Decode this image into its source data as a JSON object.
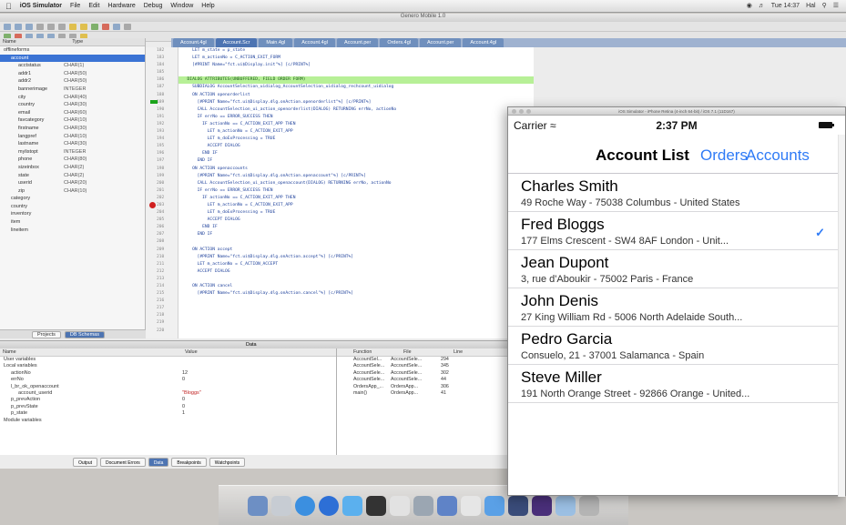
{
  "menubar": {
    "app": "iOS Simulator",
    "items": [
      "File",
      "Edit",
      "Hardware",
      "Debug",
      "Window",
      "Help"
    ],
    "clock": "Tue 14:37",
    "user": "Hal"
  },
  "ide": {
    "window_title": "Genero Mobile 1.0",
    "tabs": [
      "Account.4gl",
      "Account.Scr",
      "Main.4gl",
      "Account.4gl",
      "Account.per",
      "Orders.4gl",
      "Account.per",
      "Account.4gl"
    ],
    "navigator": {
      "header_cols": [
        "Name",
        "Type"
      ],
      "rows": [
        {
          "name": "offlineforms",
          "type": "",
          "indent": 0
        },
        {
          "name": "account",
          "type": "",
          "indent": 1,
          "selected": true
        },
        {
          "name": "acctstatus",
          "type": "CHAR(1)",
          "indent": 2
        },
        {
          "name": "addr1",
          "type": "CHAR(50)",
          "indent": 2
        },
        {
          "name": "addr2",
          "type": "CHAR(50)",
          "indent": 2
        },
        {
          "name": "bannerimage",
          "type": "INTEGER",
          "indent": 2
        },
        {
          "name": "city",
          "type": "CHAR(40)",
          "indent": 2
        },
        {
          "name": "country",
          "type": "CHAR(30)",
          "indent": 2
        },
        {
          "name": "email",
          "type": "CHAR(60)",
          "indent": 2
        },
        {
          "name": "favcategory",
          "type": "CHAR(10)",
          "indent": 2
        },
        {
          "name": "firstname",
          "type": "CHAR(30)",
          "indent": 2
        },
        {
          "name": "langpref",
          "type": "CHAR(10)",
          "indent": 2
        },
        {
          "name": "lastname",
          "type": "CHAR(30)",
          "indent": 2
        },
        {
          "name": "mylistopt",
          "type": "INTEGER",
          "indent": 2
        },
        {
          "name": "phone",
          "type": "CHAR(80)",
          "indent": 2
        },
        {
          "name": "sizeinbox",
          "type": "CHAR(2)",
          "indent": 2
        },
        {
          "name": "state",
          "type": "CHAR(2)",
          "indent": 2
        },
        {
          "name": "userid",
          "type": "CHAR(20)",
          "indent": 2
        },
        {
          "name": "zip",
          "type": "CHAR(10)",
          "indent": 2
        },
        {
          "name": "category",
          "type": "",
          "indent": 1
        },
        {
          "name": "country",
          "type": "",
          "indent": 1
        },
        {
          "name": "inventory",
          "type": "",
          "indent": 1
        },
        {
          "name": "item",
          "type": "",
          "indent": 1
        },
        {
          "name": "lineitem",
          "type": "",
          "indent": 1
        }
      ],
      "footer_tabs": [
        "Projects",
        "DB Schemas"
      ]
    },
    "gutter_lines": [
      "182",
      "183",
      "184",
      "185",
      "186",
      "187",
      "188",
      "189",
      "190",
      "191",
      "192",
      "193",
      "194",
      "195",
      "196",
      "197",
      "198",
      "199",
      "200",
      "201",
      "202",
      "203",
      "204",
      "205",
      "206",
      "207",
      "208",
      "209",
      "210",
      "211",
      "212",
      "213",
      "214",
      "215",
      "216",
      "217",
      "218",
      "219",
      "220"
    ],
    "code_lines": [
      "    LET m_state = p_state",
      "    LET m_actionNo = C_ACTION_EXIT_FORM",
      "    [#PRINT Name=\"fct.ui$Display.init\"%] [c/PRINT%]",
      "",
      "  DIALOG ATTRIBUTES(UNBUFFERED, FIELD ORDER FORM)",
      "    SUBDIALOG AccountSelection_uidialog_AccountSelection_uidialog_rechcount_uidialog",
      "    ON ACTION openorderlist",
      "      [#PRINT Name=\"fct.ui$Display.dlg.onAction.openorderlist\"%] [c/PRINT%]",
      "      CALL AccountSelection_ui_action_openorderlist(DIALOG) RETURNING errNo, actionNo",
      "      IF errNo == ERROR_SUCCESS THEN",
      "        IF actionNo == C_ACTION_EXIT_APP THEN",
      "          LET m_actionNo = C_ACTION_EXIT_APP",
      "          LET m_doExProcessing = TRUE",
      "          ACCEPT DIALOG",
      "        END IF",
      "      END IF",
      "    ON ACTION openaccounts",
      "      [#PRINT Name=\"fct.ui$Display.dlg.onAction.openaccount\"%] [c/PRINT%]",
      "      CALL AccountSelection_ui_action_openaccount(DIALOG) RETURNING errNo, actionNo",
      "      IF errNo == ERROR_SUCCESS THEN",
      "        IF actionNo == C_ACTION_EXIT_APP THEN",
      "          LET m_actionNo = C_ACTION_EXIT_APP",
      "          LET m_doExProcessing = TRUE",
      "          ACCEPT DIALOG",
      "        END IF",
      "      END IF",
      "",
      "    ON ACTION accept",
      "      [#PRINT Name=\"fct.ui$Display.dlg.onAction.accept\"%] [c/PRINT%]",
      "      LET m_actionNo = C_ACTION_ACCEPT",
      "      ACCEPT DIALOG",
      "",
      "    ON ACTION cancel",
      "      [#PRINT Name=\"fct.ui$Display.dlg.onAction.cancel\"%] [c/PRINT%]"
    ],
    "current_line_index": 4,
    "debug_bar_title": "Data",
    "variables": {
      "header": [
        "Name",
        "Value"
      ],
      "rows": [
        {
          "name": "User variables",
          "value": "",
          "indent": 0
        },
        {
          "name": "Local variables",
          "value": "",
          "indent": 0
        },
        {
          "name": "actionNo",
          "value": "12",
          "indent": 1
        },
        {
          "name": "errNo",
          "value": "0",
          "indent": 1
        },
        {
          "name": "l_br_ok_openaccount",
          "value": "",
          "indent": 1
        },
        {
          "name": "account_userid",
          "value": "\"Bloggs\"",
          "indent": 2,
          "string": true
        },
        {
          "name": "p_prevAction",
          "value": "0",
          "indent": 1
        },
        {
          "name": "p_prevState",
          "value": "0",
          "indent": 1
        },
        {
          "name": "p_state",
          "value": "1",
          "indent": 1
        },
        {
          "name": "Module variables",
          "value": "",
          "indent": 0
        }
      ]
    },
    "output_tabs": [
      "Output",
      "Document Errors",
      "Data",
      "Breakpoints",
      "Watchpoints"
    ],
    "stack": {
      "header": [
        "Function",
        "File",
        "Line"
      ],
      "rows": [
        [
          "AccountSel...",
          "AccountSele...",
          "294"
        ],
        [
          "AccountSele...",
          "AccountSele...",
          "345"
        ],
        [
          "AccountSele...",
          "AccountSele...",
          "302"
        ],
        [
          "AccountSele...",
          "AccountSele...",
          "44"
        ],
        [
          "OrdersApp_...",
          "OrdersApp...",
          "306"
        ],
        [
          "main()",
          "OrdersApp...",
          "41"
        ]
      ]
    }
  },
  "simulator": {
    "window_title": "iOS Simulator - iPhone Retina (4-inch 64-bit) / iOS 7.1 (11D167)",
    "status": {
      "carrier": "Carrier",
      "time": "2:37 PM"
    },
    "nav": {
      "title": "Account List",
      "orders": "Orders",
      "accounts": "Accounts"
    },
    "accent": "#2f7bf6",
    "accounts": [
      {
        "name": "Charles Smith",
        "address": "49 Roche Way - 75038 Columbus - United States",
        "checked": false
      },
      {
        "name": "Fred Bloggs",
        "address": "177 Elms Crescent - SW4 8AF London - Unit...",
        "checked": true
      },
      {
        "name": "Jean Dupont",
        "address": "3, rue d'Aboukir - 75002 Paris - France",
        "checked": false
      },
      {
        "name": "John Denis",
        "address": "27 King William Rd - 5006 North Adelaide South...",
        "checked": false
      },
      {
        "name": "Pedro Garcia",
        "address": "Consuelo, 21 - 37001 Salamanca - Spain",
        "checked": false
      },
      {
        "name": "Steve Miller",
        "address": "191 North Orange Street - 92866 Orange - United...",
        "checked": false
      }
    ]
  }
}
